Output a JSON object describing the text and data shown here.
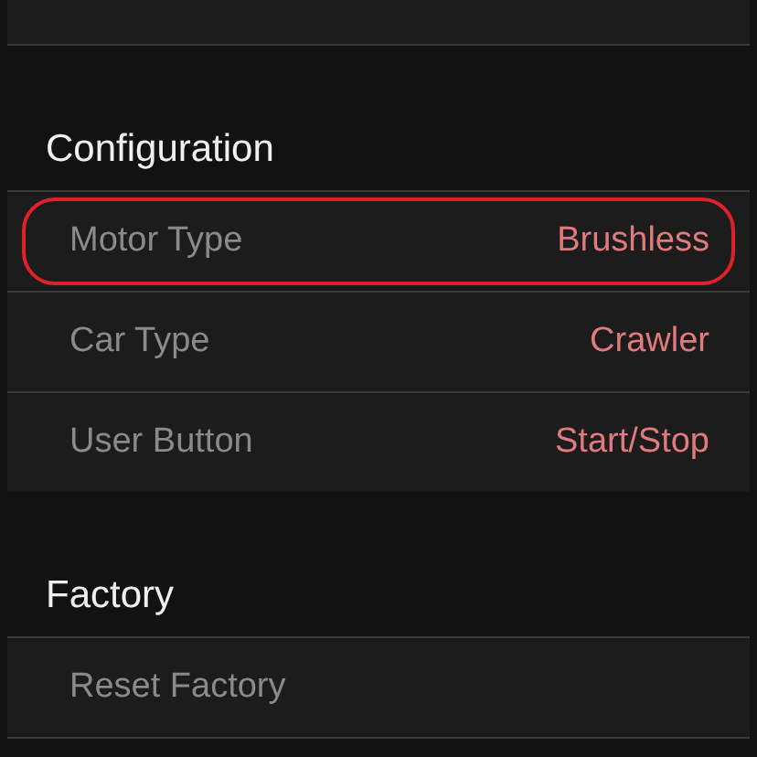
{
  "sections": [
    {
      "title": "Configuration",
      "rows": [
        {
          "label": "Motor Type",
          "value": "Brushless",
          "highlighted": true
        },
        {
          "label": "Car Type",
          "value": "Crawler",
          "highlighted": false
        },
        {
          "label": "User Button",
          "value": "Start/Stop",
          "highlighted": false
        }
      ]
    },
    {
      "title": "Factory",
      "rows": [
        {
          "label": "Reset Factory",
          "highlighted": false
        }
      ]
    }
  ]
}
